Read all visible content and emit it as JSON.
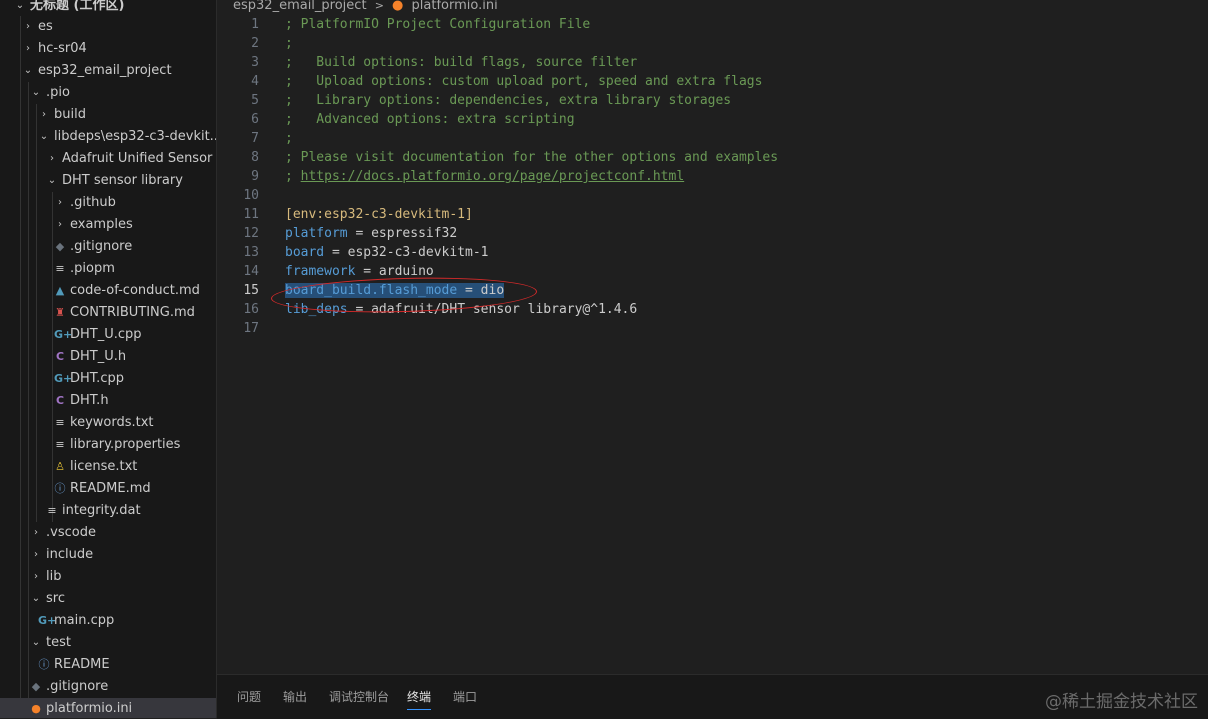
{
  "explorer": {
    "workspace_title": "无标题 (工作区)",
    "items": [
      {
        "label": "es",
        "chev": "›",
        "icon": "",
        "icon_class": ""
      },
      {
        "label": "hc-sr04",
        "chev": "›",
        "icon": "",
        "icon_class": ""
      },
      {
        "label": "esp32_email_project",
        "chev": "⌄",
        "icon": "",
        "icon_class": ""
      },
      {
        "label": ".pio",
        "chev": "⌄",
        "icon": "",
        "icon_class": ""
      },
      {
        "label": "build",
        "chev": "›",
        "icon": "",
        "icon_class": ""
      },
      {
        "label": "libdeps\\esp32-c3-devkit...",
        "chev": "⌄",
        "icon": "",
        "icon_class": ""
      },
      {
        "label": "Adafruit Unified Sensor",
        "chev": "›",
        "icon": "",
        "icon_class": ""
      },
      {
        "label": "DHT sensor library",
        "chev": "⌄",
        "icon": "",
        "icon_class": ""
      },
      {
        "label": ".github",
        "chev": "›",
        "icon": "",
        "icon_class": ""
      },
      {
        "label": "examples",
        "chev": "›",
        "icon": "",
        "icon_class": ""
      },
      {
        "label": ".gitignore",
        "chev": "",
        "icon": "◆",
        "icon_class": "ic-git"
      },
      {
        "label": ".piopm",
        "chev": "",
        "icon": "≡",
        "icon_class": "ic-txt"
      },
      {
        "label": "code-of-conduct.md",
        "chev": "",
        "icon": "▲",
        "icon_class": "ic-cpp"
      },
      {
        "label": "CONTRIBUTING.md",
        "chev": "",
        "icon": "♜",
        "icon_class": "ic-contrib"
      },
      {
        "label": "DHT_U.cpp",
        "chev": "",
        "icon": "G+",
        "icon_class": "ic-cpp"
      },
      {
        "label": "DHT_U.h",
        "chev": "",
        "icon": "C",
        "icon_class": "ic-c"
      },
      {
        "label": "DHT.cpp",
        "chev": "",
        "icon": "G+",
        "icon_class": "ic-cpp"
      },
      {
        "label": "DHT.h",
        "chev": "",
        "icon": "C",
        "icon_class": "ic-c"
      },
      {
        "label": "keywords.txt",
        "chev": "",
        "icon": "≡",
        "icon_class": "ic-txt"
      },
      {
        "label": "library.properties",
        "chev": "",
        "icon": "≡",
        "icon_class": "ic-txt"
      },
      {
        "label": "license.txt",
        "chev": "",
        "icon": "♙",
        "icon_class": "ic-lic"
      },
      {
        "label": "README.md",
        "chev": "",
        "icon": "ⓘ",
        "icon_class": "ic-info"
      },
      {
        "label": "integrity.dat",
        "chev": "",
        "icon": "≡",
        "icon_class": "ic-txt"
      },
      {
        "label": ".vscode",
        "chev": "›",
        "icon": "",
        "icon_class": ""
      },
      {
        "label": "include",
        "chev": "›",
        "icon": "",
        "icon_class": ""
      },
      {
        "label": "lib",
        "chev": "›",
        "icon": "",
        "icon_class": ""
      },
      {
        "label": "src",
        "chev": "⌄",
        "icon": "",
        "icon_class": ""
      },
      {
        "label": "main.cpp",
        "chev": "",
        "icon": "G+",
        "icon_class": "ic-cpp"
      },
      {
        "label": "test",
        "chev": "⌄",
        "icon": "",
        "icon_class": ""
      },
      {
        "label": "README",
        "chev": "",
        "icon": "ⓘ",
        "icon_class": "ic-info"
      },
      {
        "label": ".gitignore",
        "chev": "",
        "icon": "◆",
        "icon_class": "ic-git"
      },
      {
        "label": "platformio.ini",
        "chev": "",
        "icon": "●",
        "icon_class": "ic-pio"
      }
    ]
  },
  "breadcrumb": {
    "folder": "esp32_email_project",
    "separator": ">",
    "file": "platformio.ini"
  },
  "editor": {
    "active_line": 15,
    "lines": [
      {
        "n": "1",
        "code": "; PlatformIO Project Configuration File"
      },
      {
        "n": "2",
        "code": ";"
      },
      {
        "n": "3",
        "code": ";   Build options: build flags, source filter"
      },
      {
        "n": "4",
        "code": ";   Upload options: custom upload port, speed and extra flags"
      },
      {
        "n": "5",
        "code": ";   Library options: dependencies, extra library storages"
      },
      {
        "n": "6",
        "code": ";   Advanced options: extra scripting"
      },
      {
        "n": "7",
        "code": ";"
      },
      {
        "n": "8",
        "code": "; Please visit documentation for the other options and examples"
      },
      {
        "n": "9",
        "code": "; https://docs.platformio.org/page/projectconf.html"
      },
      {
        "n": "10",
        "code": ""
      },
      {
        "n": "11",
        "code": "[env:esp32-c3-devkitm-1]"
      },
      {
        "n": "12",
        "code": "platform = espressif32"
      },
      {
        "n": "13",
        "code": "board = esp32-c3-devkitm-1"
      },
      {
        "n": "14",
        "code": "framework = arduino"
      },
      {
        "n": "15",
        "code": "board_build.flash_mode = dio"
      },
      {
        "n": "16",
        "code": "lib_deps = adafruit/DHT sensor library@^1.4.6"
      },
      {
        "n": "17",
        "code": ""
      }
    ]
  },
  "panel": {
    "tabs": [
      "问题",
      "输出",
      "调试控制台",
      "终端",
      "端口"
    ],
    "active_tab": "终端"
  },
  "watermark": "@稀土掘金技术社区",
  "colors": {
    "editor_bg": "#1f1f1f",
    "sidebar_bg": "#181818",
    "comment": "#6a9955",
    "key": "#569cd6",
    "section": "#d7ba7d",
    "selection": "#264f78",
    "annotation": "#d42a2a",
    "accent": "#3794ff"
  }
}
